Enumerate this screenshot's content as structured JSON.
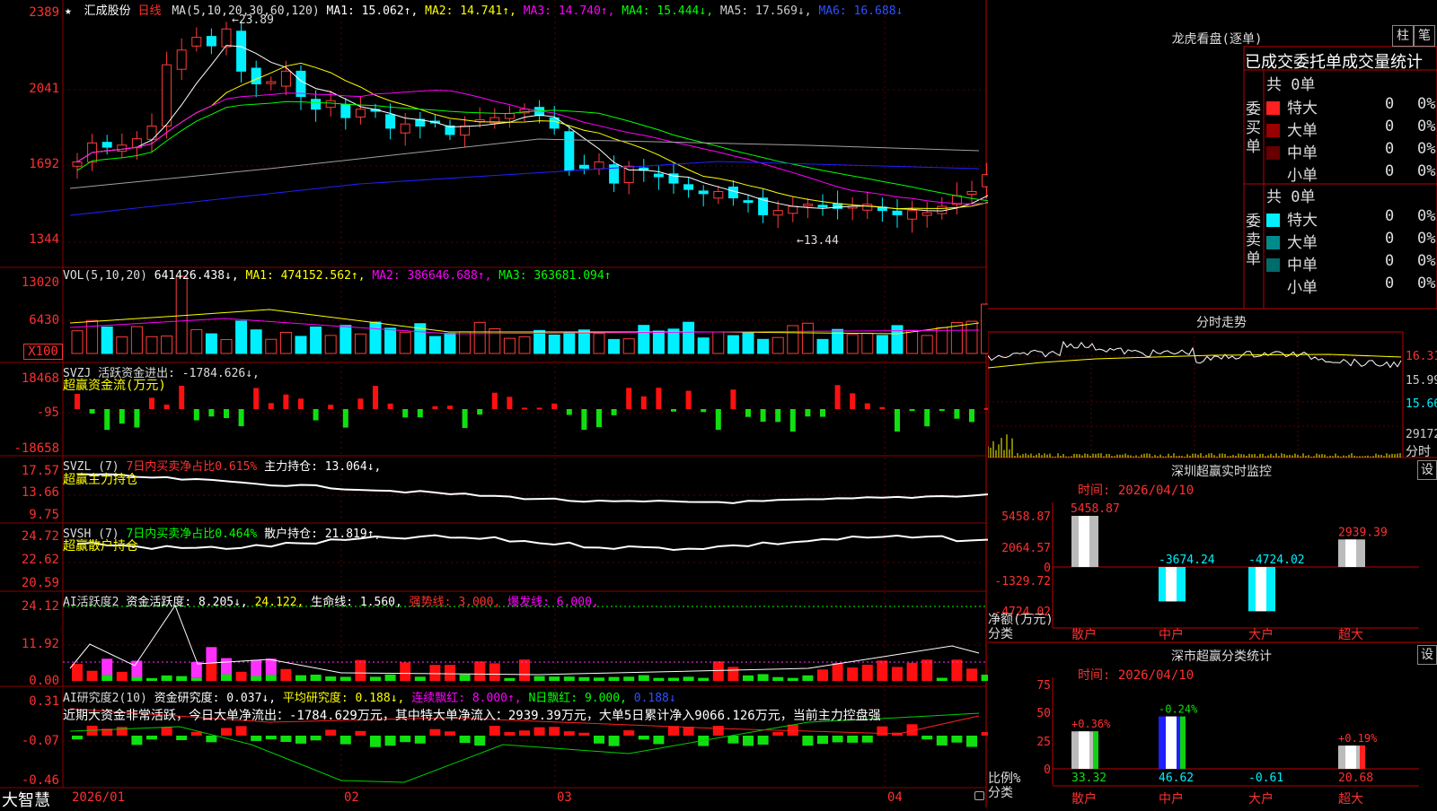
{
  "colors": {
    "up": "#ff3b3b",
    "down": "#00f0ff",
    "grid": "#8b0000",
    "axis": "#ff3030",
    "ma1": "#ffffff",
    "ma2": "#ffff00",
    "ma3": "#ff00ff",
    "ma4": "#00ff00",
    "ma5": "#a0a0a0",
    "ma6": "#2020ff"
  },
  "header": {
    "star": "★",
    "stock": "汇成股份",
    "period": "日线",
    "ma_label": "MA(5,10,20,30,60,120)",
    "ma1": "MA1: 15.062↑,",
    "ma2": "MA2: 14.741↑,",
    "ma3": "MA3: 14.740↑,",
    "ma4": "MA4: 15.444↓,",
    "ma5": "MA5: 17.569↓,",
    "ma6": "MA6: 16.688↓"
  },
  "price_axis": [
    "2389",
    "2041",
    "1692",
    "1344"
  ],
  "annotations": {
    "high": "23.89",
    "low": "13.44"
  },
  "vol": {
    "label": "VOL(5,10,20)",
    "value": "641426.438↓,",
    "ma1": "MA1: 474152.562↑,",
    "ma2": "MA2: 386646.688↑,",
    "ma3": "MA3: 363681.094↑",
    "axis": [
      "13020",
      "6430",
      "X100"
    ]
  },
  "svzj": {
    "label": "SVZJ  活跃资金进出: -1784.626↓,",
    "sub": "超赢资金流(万元)",
    "axis": [
      "18468",
      "-95",
      "-18658"
    ]
  },
  "svzl": {
    "label": "SVZL (7)",
    "part1": "7日内买卖净占比0.615%",
    "part2": "主力持仓: 13.064↓,",
    "sub": "超赢主力持仓",
    "axis": [
      "17.57",
      "13.66",
      "9.75"
    ]
  },
  "svsh": {
    "label": "SVSH (7)",
    "part1": "7日内买卖净占比0.464%",
    "part2": "散户持仓: 21.819↑,",
    "sub": "超赢散户持仓",
    "axis": [
      "24.72",
      "22.62",
      "20.59"
    ]
  },
  "ai_active": {
    "label": "AI活跃度2",
    "p1": "资金活跃度: 8.205↓,",
    "p2": "24.122,",
    "p3": "生命线: 1.560,",
    "p4": "强势线: 3.000,",
    "p5": "爆发线: 6.000,",
    "axis": [
      "24.12",
      "11.92",
      "0.00"
    ]
  },
  "ai_research": {
    "label": "AI研究度2(10)",
    "p1": "资金研究度: 0.037↓,",
    "p2": "平均研究度: 0.188↓,",
    "p3": "连续飘红: 8.000↑,",
    "p4": "N日飘红: 9.000,",
    "p5": "0.188↓",
    "note": "近期大资金非常活跃，今日大单净流出：-1784.629万元，其中特大单净流入：2939.39万元，大单5日累计净入9066.126万元，当前主力控盘强",
    "axis": [
      "0.31",
      "-0.07",
      "-0.46"
    ]
  },
  "dates": [
    "2026/01",
    "02",
    "03",
    "04"
  ],
  "brand": "大智慧",
  "dragon": {
    "title": "龙虎看盘(逐单)",
    "tab1": "柱",
    "tab2": "笔",
    "subtitle": "已成交委托单成交量统计",
    "buy_label": "委买单",
    "sell_label": "委卖单",
    "buy_total": "共 0单",
    "sell_total": "共 0单",
    "buy_rows": [
      {
        "name": "特大",
        "v": "0",
        "p": "0%",
        "color": "#ff2020"
      },
      {
        "name": "大单",
        "v": "0",
        "p": "0%",
        "color": "#990000"
      },
      {
        "name": "中单",
        "v": "0",
        "p": "0%",
        "color": "#660000"
      },
      {
        "name": "小单",
        "v": "0",
        "p": "0%",
        "color": ""
      }
    ],
    "sell_rows": [
      {
        "name": "特大",
        "v": "0",
        "p": "0%",
        "color": "#00f0ff"
      },
      {
        "name": "大单",
        "v": "0",
        "p": "0%",
        "color": "#008b8b"
      },
      {
        "name": "中单",
        "v": "0",
        "p": "0%",
        "color": "#006b6b"
      },
      {
        "name": "小单",
        "v": "0",
        "p": "0%",
        "color": ""
      }
    ]
  },
  "intraday": {
    "title": "分时走势",
    "axis": [
      "16.31",
      "15.99",
      "15.66"
    ],
    "vol_axis": "29172",
    "vol_label": "分时"
  },
  "monitor": {
    "title": "深圳超赢实时监控",
    "btn": "设",
    "time": "时间: 2026/04/10",
    "axis": [
      "5458.87",
      "2064.57",
      "0",
      "-1329.72",
      "-4724.02"
    ],
    "ylabel": "净额(万元)",
    "xlabel": "分类",
    "cats": [
      "散户",
      "中户",
      "大户",
      "超大"
    ],
    "values": [
      "5458.87",
      "-3674.24",
      "-4724.02",
      "2939.39"
    ]
  },
  "classify": {
    "title": "深市超赢分类统计",
    "btn": "设",
    "time": "时间: 2026/04/10",
    "axis": [
      "75",
      "50",
      "25",
      "0"
    ],
    "ylabel": "比例%",
    "xlabel": "分类",
    "cats": [
      "散户",
      "中户",
      "大户",
      "超大"
    ],
    "values": [
      "33.32",
      "46.62",
      "-0.61",
      "20.68"
    ],
    "changes": [
      "+0.36%",
      "-0.24%",
      "",
      "+0.19%"
    ]
  }
}
